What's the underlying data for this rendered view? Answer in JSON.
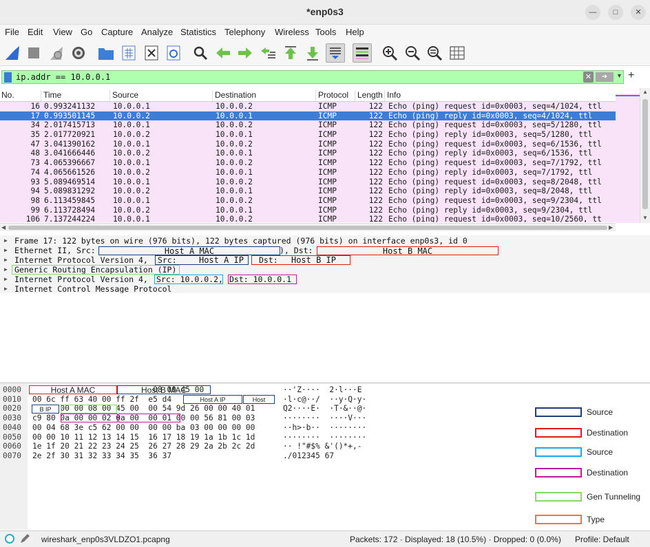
{
  "window": {
    "title": "*enp0s3"
  },
  "menu": [
    "File",
    "Edit",
    "View",
    "Go",
    "Capture",
    "Analyze",
    "Statistics",
    "Telephony",
    "Wireless",
    "Tools",
    "Help"
  ],
  "filter": {
    "value": "ip.addr == 10.0.0.1"
  },
  "columns": [
    "No.",
    "Time",
    "Source",
    "Destination",
    "Protocol",
    "Length",
    "Info"
  ],
  "packets": [
    {
      "no": "16",
      "time": "0.993241132",
      "src": "10.0.0.1",
      "dst": "10.0.0.2",
      "proto": "ICMP",
      "len": "122",
      "info": "Echo (ping) request  id=0x0003, seq=4/1024, ttl"
    },
    {
      "no": "17",
      "time": "0.993501145",
      "src": "10.0.0.2",
      "dst": "10.0.0.1",
      "proto": "ICMP",
      "len": "122",
      "info": "Echo (ping) reply    id=0x0003, seq=4/1024, ttl"
    },
    {
      "no": "34",
      "time": "2.017415713",
      "src": "10.0.0.1",
      "dst": "10.0.0.2",
      "proto": "ICMP",
      "len": "122",
      "info": "Echo (ping) request  id=0x0003, seq=5/1280, ttl"
    },
    {
      "no": "35",
      "time": "2.017720921",
      "src": "10.0.0.2",
      "dst": "10.0.0.1",
      "proto": "ICMP",
      "len": "122",
      "info": "Echo (ping) reply    id=0x0003, seq=5/1280, ttl"
    },
    {
      "no": "47",
      "time": "3.041390162",
      "src": "10.0.0.1",
      "dst": "10.0.0.2",
      "proto": "ICMP",
      "len": "122",
      "info": "Echo (ping) request  id=0x0003, seq=6/1536, ttl"
    },
    {
      "no": "48",
      "time": "3.041666446",
      "src": "10.0.0.2",
      "dst": "10.0.0.1",
      "proto": "ICMP",
      "len": "122",
      "info": "Echo (ping) reply    id=0x0003, seq=6/1536, ttl"
    },
    {
      "no": "73",
      "time": "4.065396667",
      "src": "10.0.0.1",
      "dst": "10.0.0.2",
      "proto": "ICMP",
      "len": "122",
      "info": "Echo (ping) request  id=0x0003, seq=7/1792, ttl"
    },
    {
      "no": "74",
      "time": "4.065661526",
      "src": "10.0.0.2",
      "dst": "10.0.0.1",
      "proto": "ICMP",
      "len": "122",
      "info": "Echo (ping) reply    id=0x0003, seq=7/1792, ttl"
    },
    {
      "no": "93",
      "time": "5.089469514",
      "src": "10.0.0.1",
      "dst": "10.0.0.2",
      "proto": "ICMP",
      "len": "122",
      "info": "Echo (ping) request  id=0x0003, seq=8/2048, ttl"
    },
    {
      "no": "94",
      "time": "5.089831292",
      "src": "10.0.0.2",
      "dst": "10.0.0.1",
      "proto": "ICMP",
      "len": "122",
      "info": "Echo (ping) reply    id=0x0003, seq=8/2048, ttl"
    },
    {
      "no": "98",
      "time": "6.113459845",
      "src": "10.0.0.1",
      "dst": "10.0.0.2",
      "proto": "ICMP",
      "len": "122",
      "info": "Echo (ping) request  id=0x0003, seq=9/2304, ttl"
    },
    {
      "no": "99",
      "time": "6.113728494",
      "src": "10.0.0.2",
      "dst": "10.0.0.1",
      "proto": "ICMP",
      "len": "122",
      "info": "Echo (ping) reply    id=0x0003, seq=9/2304, ttl"
    },
    {
      "no": "106",
      "time": "7.137244224",
      "src": "10.0.0.1",
      "dst": "10.0.0.2",
      "proto": "ICMP",
      "len": "122",
      "info": "Echo (ping) request  id=0x0003, seq=10/2560, tt"
    }
  ],
  "details": {
    "frame": "Frame 17: 122 bytes on wire (976 bits), 122 bytes captured (976 bits) on interface enp0s3, id 0",
    "eth_prefix": "Ethernet II, Src:",
    "eth_mid": "), Dst:",
    "ip_outer": "Internet Protocol Version 4,",
    "gre": "Generic Routing Encapsulation (IP)",
    "ip_inner": "Internet Protocol Version 4,",
    "ip_inner_src": "Src: 10.0.0.2,",
    "ip_inner_dst": "Dst: 10.0.0.1",
    "icmp": "Internet Control Message Protocol",
    "ip_outer_src_label": "Src:",
    "ip_outer_dst_label": "Dst:"
  },
  "annotations": {
    "host_a_mac": "Host A MAC",
    "host_b_mac": "Host B MAC",
    "host_a_ip": "Host A IP",
    "host_b_ip": "Host B IP",
    "host_a_ip_small": "Host A IP",
    "host_small": "Host",
    "b_ip_small": "B IP"
  },
  "bytes": [
    {
      "off": "0000",
      "hex": "                          08 00 45 00",
      "asc": "··'Z····  2·l···E"
    },
    {
      "off": "0010",
      "hex": "00 6c ff 63 40 00 ff 2f  e5 d4",
      "asc": "·l·c@··/  ··y·Q·y·"
    },
    {
      "off": "0020",
      "hex": "      00 00 08 00 45 00  00 54 9d 26 00 00 40 01",
      "asc": "Q2····E·  ·T·&··@·"
    },
    {
      "off": "0030",
      "hex": "c9 80 0a 00 00 02 0a 00  00 01 00 00 56 81 00 03",
      "asc": "········  ····V···"
    },
    {
      "off": "0040",
      "hex": "00 04 68 3e c5 62 00 00  00 00 ba 03 00 00 00 00",
      "asc": "··h>·b··  ········"
    },
    {
      "off": "0050",
      "hex": "00 00 10 11 12 13 14 15  16 17 18 19 1a 1b 1c 1d",
      "asc": "········  ········"
    },
    {
      "off": "0060",
      "hex": "1e 1f 20 21 22 23 24 25  26 27 28 29 2a 2b 2c 2d",
      "asc": "·· !\"#$% &'()*+,-"
    },
    {
      "off": "0070",
      "hex": "2e 2f 30 31 32 33 34 35  36 37",
      "asc": "./012345 67"
    }
  ],
  "legend": [
    {
      "label": "Source",
      "color": "#1f3f7a"
    },
    {
      "label": "Destination",
      "color": "#e01a1a"
    },
    {
      "label": "Source",
      "color": "#1aa8e8"
    },
    {
      "label": "Destination",
      "color": "#c2189a"
    },
    {
      "label": "Gen Tunneling",
      "color": "#8ad86a"
    },
    {
      "label": "Type",
      "color": "#f07830"
    }
  ],
  "status": {
    "file": "wireshark_enp0s3VLDZO1.pcapng",
    "counts": "Packets: 172 · Displayed: 18 (10.5%) · Dropped: 0 (0.0%)",
    "profile": "Profile: Default"
  }
}
